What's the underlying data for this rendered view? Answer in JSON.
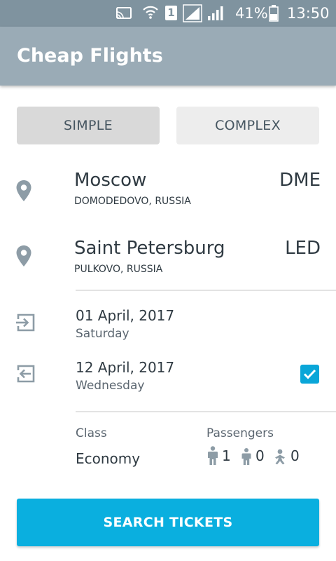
{
  "status_bar": {
    "sim_label": "1",
    "battery_text": "41%",
    "time": "13:50",
    "icons": [
      "cast-icon",
      "wifi-icon",
      "sim-icon",
      "signal-icon",
      "signal-icon",
      "battery-icon"
    ]
  },
  "app_bar": {
    "title": "Cheap Flights"
  },
  "mode_tabs": [
    {
      "label": "SIMPLE",
      "selected": true
    },
    {
      "label": "COMPLEX",
      "selected": false
    }
  ],
  "origin": {
    "city": "Moscow",
    "airport": "DOMODEDOVO, RUSSIA",
    "code": "DME",
    "icon": "location-pin-icon"
  },
  "destination": {
    "city": "Saint Petersburg",
    "airport": "PULKOVO, RUSSIA",
    "code": "LED",
    "icon": "location-pin-icon"
  },
  "departure": {
    "date": "01 April, 2017",
    "weekday": "Saturday",
    "icon": "departure-icon"
  },
  "return": {
    "date": "12 April, 2017",
    "weekday": "Wednesday",
    "icon": "return-icon",
    "enabled": true
  },
  "trip_class": {
    "label": "Class",
    "value": "Economy"
  },
  "passengers": {
    "label": "Passengers",
    "adults": "1",
    "children": "0",
    "infants": "0"
  },
  "search_button": {
    "label": "SEARCH TICKETS"
  },
  "colors": {
    "status_bar": "#7f939f",
    "app_bar": "#9aabb6",
    "accent": "#0aafdf",
    "icon_gray": "#8d9ca6",
    "text_dark": "#2f3a42"
  }
}
